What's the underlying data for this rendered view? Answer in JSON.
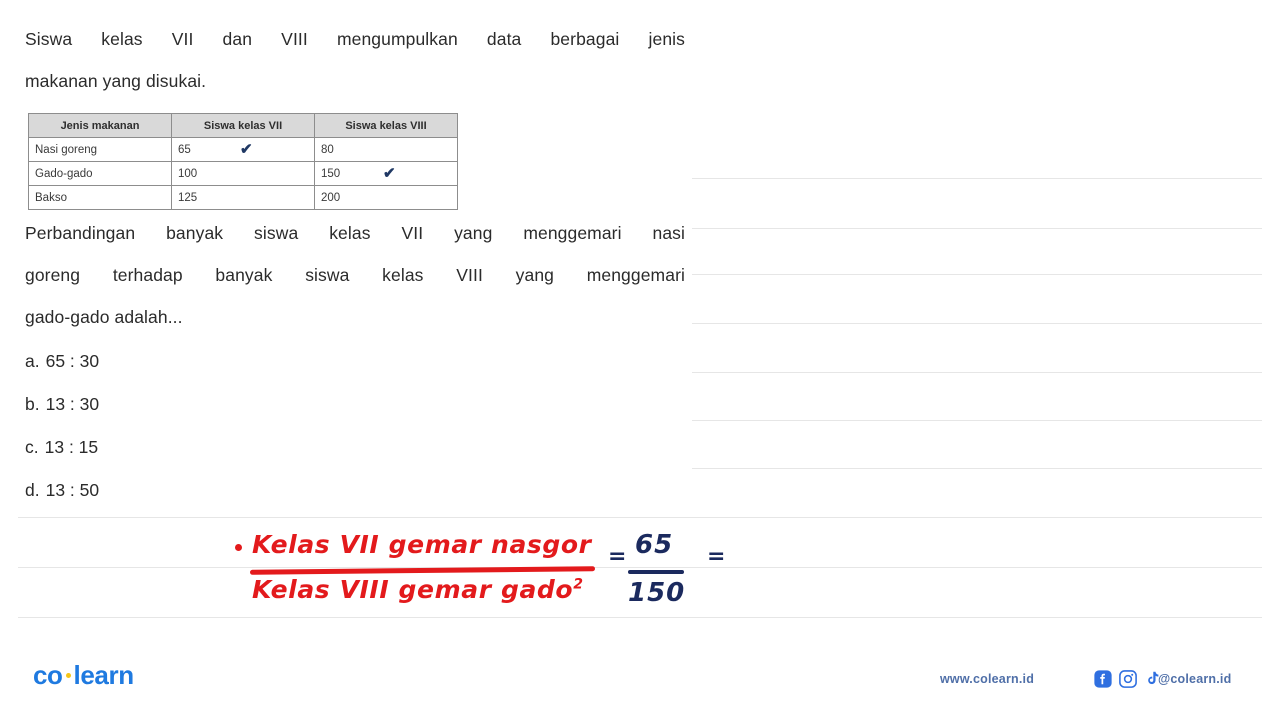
{
  "question": {
    "line1": "Siswa kelas VII dan VIII mengumpulkan data berbagai jenis",
    "line2": "makanan yang disukai.",
    "line3": "Perbandingan banyak siswa kelas VII yang menggemari nasi",
    "line4": "goreng terhadap banyak siswa kelas VIII yang menggemari",
    "line5": "gado-gado adalah..."
  },
  "table": {
    "headers": [
      "Jenis makanan",
      "Siswa kelas VII",
      "Siswa kelas VIII"
    ],
    "rows": [
      {
        "food": "Nasi goreng",
        "vii": "65",
        "viii": "80",
        "tick_vii": "✔",
        "tick_viii": ""
      },
      {
        "food": "Gado-gado",
        "vii": "100",
        "viii": "150",
        "tick_vii": "",
        "tick_viii": "✔"
      },
      {
        "food": "Bakso",
        "vii": "125",
        "viii": "200",
        "tick_vii": "",
        "tick_viii": ""
      }
    ]
  },
  "options": [
    {
      "key": "a.",
      "value": "65 : 30"
    },
    {
      "key": "b.",
      "value": "13 : 30"
    },
    {
      "key": "c.",
      "value": "13 : 15"
    },
    {
      "key": "d.",
      "value": "13 : 50"
    }
  ],
  "annotation": {
    "numerator": "Kelas VII gemar nasgor",
    "denominator_text": "Kelas VIII gemar gado",
    "denominator_sup": "2",
    "equals_first": "=",
    "equals_second": "=",
    "fraction_numerator": "65",
    "fraction_denominator": "150",
    "red_color": "#e31a1c",
    "blue_color": "#1b2a5e"
  },
  "footer": {
    "logo_left": "co",
    "logo_right": "learn",
    "url": "www.colearn.id",
    "handle": "@colearn.id",
    "brand_color": "#1f7ae0",
    "social": [
      "facebook-icon",
      "instagram-icon",
      "tiktok-icon"
    ]
  }
}
